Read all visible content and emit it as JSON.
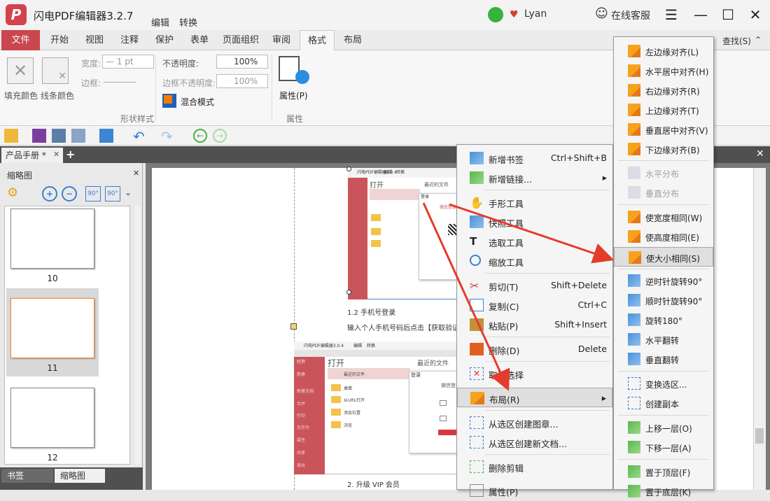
{
  "app": {
    "title": "闪电PDF编辑器3.2.7",
    "logo_letter": "P",
    "menu_edit": "编辑",
    "menu_convert": "转换",
    "user": "Lyan",
    "service": "在线客服"
  },
  "menu": {
    "tabs": [
      "文件",
      "开始",
      "视图",
      "注释",
      "保护",
      "表单",
      "页面组织",
      "审阅",
      "格式",
      "布局"
    ],
    "right_text": "查找(S)"
  },
  "ribbon": {
    "fill_color": "填充颜色",
    "line_color": "线条颜色",
    "width_label": "宽度:",
    "width_value": "— 1 pt",
    "border_label": "边框:",
    "opacity_label": "不透明度:",
    "opacity_value": "100%",
    "border_opacity_label": "边框不透明度:",
    "border_opacity_value": "100%",
    "blend_mode": "混合模式",
    "group_shape_style": "形状样式",
    "properties": "属性(P)",
    "group_properties": "属性"
  },
  "doc_tab": {
    "name": "产品手册 *"
  },
  "left_panel": {
    "title": "缩略图",
    "thumbnails": [
      "10",
      "11",
      "12"
    ],
    "tab_bookmarks": "书签",
    "tab_thumbs": "缩略图"
  },
  "page": {
    "caption_login": "1.2 手机号登录",
    "caption_instruction": "输入个人手机号码后点击【获取验证码】",
    "caption_vip": "2. 升级 VIP 会员",
    "shot1": {
      "title": "闪电PDF编辑器3.0.4",
      "menu_edit": "编辑",
      "menu_convert": "转换",
      "sidebar_open": "打开",
      "recent": "最近的文件",
      "popup": "微信登录",
      "login_tab": "登录"
    },
    "shot2": {
      "title": "闪电PDF编辑器3.0.4",
      "menu_edit": "编辑",
      "menu_convert": "转换",
      "side_open": "打开",
      "tab_open": "打开",
      "recent": "最近的文件",
      "login_title": "登录",
      "wechat_login": "微信登录",
      "sidebar_items": [
        "打开",
        "新建",
        "新建文档",
        "合并",
        "打印",
        "另存为",
        "属性",
        "共享",
        "退出"
      ],
      "list_items": [
        "最近的文件",
        "桌面",
        "从URL打开",
        "添加位置",
        "浏览"
      ],
      "login_header": "手机号码登录"
    }
  },
  "context_menu": [
    {
      "label": "新增书签",
      "shortcut": "Ctrl+Shift+B"
    },
    {
      "label": "新增链接...",
      "shortcut": "▸"
    },
    {
      "label": "手形工具",
      "shortcut": ""
    },
    {
      "label": "快照工具",
      "shortcut": ""
    },
    {
      "label": "选取工具",
      "shortcut": ""
    },
    {
      "label": "缩放工具",
      "shortcut": ""
    },
    {
      "label": "剪切(T)",
      "shortcut": "Shift+Delete"
    },
    {
      "label": "复制(C)",
      "shortcut": "Ctrl+C"
    },
    {
      "label": "粘贴(P)",
      "shortcut": "Shift+Insert"
    },
    {
      "label": "删除(D)",
      "shortcut": "Delete"
    },
    {
      "label": "取消选择",
      "shortcut": ""
    },
    {
      "label": "布局(R)",
      "shortcut": "▸"
    },
    {
      "label": "从选区创建图章...",
      "shortcut": ""
    },
    {
      "label": "从选区创建新文档...",
      "shortcut": ""
    },
    {
      "label": "删除剪辑",
      "shortcut": ""
    },
    {
      "label": "属性(P)",
      "shortcut": ""
    }
  ],
  "submenu": [
    {
      "label": "左边缘对齐(L)"
    },
    {
      "label": "水平居中对齐(H)"
    },
    {
      "label": "右边缘对齐(R)"
    },
    {
      "label": "上边缘对齐(T)"
    },
    {
      "label": "垂直居中对齐(V)"
    },
    {
      "label": "下边缘对齐(B)"
    },
    {
      "label": "水平分布"
    },
    {
      "label": "垂直分布"
    },
    {
      "label": "使宽度相同(W)"
    },
    {
      "label": "使高度相同(E)"
    },
    {
      "label": "使大小相同(S)"
    },
    {
      "label": "逆时针旋转90°"
    },
    {
      "label": "顺时针旋转90°"
    },
    {
      "label": "旋转180°"
    },
    {
      "label": "水平翻转"
    },
    {
      "label": "垂直翻转"
    },
    {
      "label": "变换选区..."
    },
    {
      "label": "创建副本"
    },
    {
      "label": "上移一层(O)"
    },
    {
      "label": "下移一层(A)"
    },
    {
      "label": "置于顶层(F)"
    },
    {
      "label": "置于底层(K)"
    }
  ],
  "colors": {
    "accent_red": "#c9474d",
    "arrow_red": "#e53b2c"
  }
}
